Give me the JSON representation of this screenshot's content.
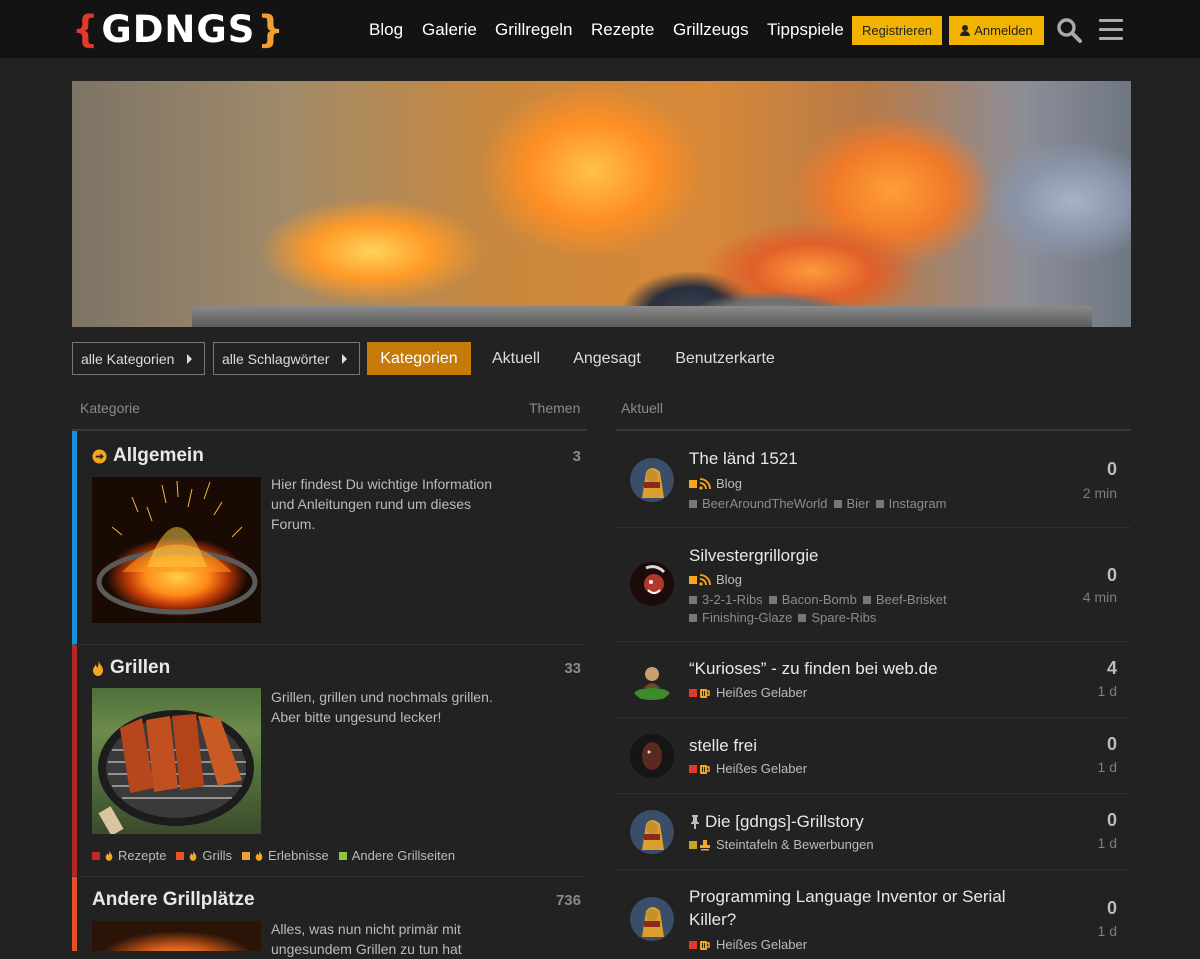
{
  "header": {
    "logo": {
      "bracket_left": "{",
      "text": "GDNGS",
      "bracket_right": "}"
    },
    "nav": [
      "Blog",
      "Galerie",
      "Grillregeln",
      "Rezepte",
      "Grillzeugs",
      "Tippspiele"
    ],
    "register_label": "Registrieren",
    "login_label": "Anmelden",
    "search_icon": "search-icon",
    "menu_icon": "hamburger-icon"
  },
  "filters": {
    "categories_dropdown": "alle Kategorien",
    "tags_dropdown": "alle Schlagwörter",
    "tabs": [
      "Kategorien",
      "Aktuell",
      "Angesagt",
      "Benutzerkarte"
    ],
    "active_tab": "Kategorien"
  },
  "categories_column": {
    "header_category": "Kategorie",
    "header_topics": "Themen",
    "items": [
      {
        "name": "Allgemein",
        "count": "3",
        "description": "Hier findest Du wichtige Information und Anleitungen rund um dieses Forum.",
        "color": "#1a8fd6",
        "icon": "arrow-circle-icon"
      },
      {
        "name": "Grillen",
        "count": "33",
        "description": "Grillen, grillen und nochmals grillen. Aber bitte ungesund lecker!",
        "color": "#b5282a",
        "icon": "flame-icon",
        "subcategories": [
          {
            "name": "Rezepte",
            "color": "#c0282a"
          },
          {
            "name": "Grills",
            "color": "#e8502a"
          },
          {
            "name": "Erlebnisse",
            "color": "#f0a030"
          },
          {
            "name": "Andere Grillseiten",
            "color": "#8ec63f"
          }
        ]
      },
      {
        "name": "Andere Grillplätze",
        "count": "736",
        "description": "Alles, was nun nicht primär mit ungesundem Grillen zu tun hat",
        "color": "#e8502a"
      }
    ]
  },
  "latest_column": {
    "header": "Aktuell",
    "topics": [
      {
        "title": "The länd 1521",
        "category": "Blog",
        "category_color": "#f5a623",
        "tags": [
          "BeerAroundTheWorld",
          "Bier",
          "Instagram"
        ],
        "posts": "0",
        "age": "2 min"
      },
      {
        "title": "Silvestergrillorgie",
        "category": "Blog",
        "category_color": "#f5a623",
        "tags": [
          "3-2-1-Ribs",
          "Bacon-Bomb",
          "Beef-Brisket",
          "Finishing-Glaze",
          "Spare-Ribs"
        ],
        "posts": "0",
        "age": "4 min"
      },
      {
        "title": "“Kurioses” - zu finden bei web.de",
        "category": "Heißes Gelaber",
        "category_color": "#e03a2a",
        "tags": [],
        "posts": "4",
        "age": "1 d"
      },
      {
        "title": "stelle frei",
        "category": "Heißes Gelaber",
        "category_color": "#e03a2a",
        "tags": [],
        "posts": "0",
        "age": "1 d"
      },
      {
        "title": "Die [gdngs]-Grillstory",
        "pinned": true,
        "category": "Steintafeln & Bewerbungen",
        "category_color": "#c9a227",
        "tags": [],
        "posts": "0",
        "age": "1 d"
      },
      {
        "title": "Programming Language Inventor or Serial Killer?",
        "category": "Heißes Gelaber",
        "category_color": "#e03a2a",
        "tags": [],
        "posts": "0",
        "age": "1 d"
      }
    ]
  }
}
